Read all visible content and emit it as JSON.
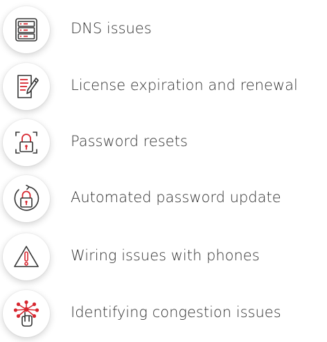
{
  "colors": {
    "accent": "#d7262f",
    "icon_stroke": "#333333",
    "text": "#333333",
    "background": "#ffffff"
  },
  "items": [
    {
      "label": "DNS issues",
      "icon": "server-icon"
    },
    {
      "label": "License expiration and renewal",
      "icon": "document-pen-icon"
    },
    {
      "label": "Password resets",
      "icon": "lock-scan-icon"
    },
    {
      "label": "Automated password update",
      "icon": "lock-refresh-icon"
    },
    {
      "label": "Wiring issues with phones",
      "icon": "warning-icon"
    },
    {
      "label": "Identifying congestion issues",
      "icon": "network-touch-icon"
    }
  ]
}
